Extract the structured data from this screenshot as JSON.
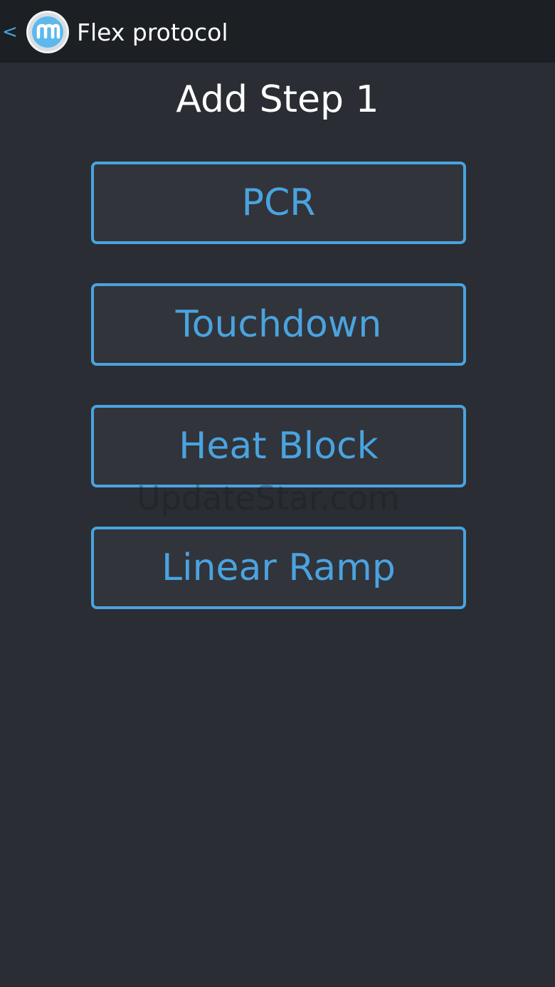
{
  "header": {
    "back_label": "<",
    "app_title": "Flex protocol",
    "logo_letter": "m"
  },
  "page": {
    "title": "Add Step 1"
  },
  "steps": [
    {
      "label": "PCR"
    },
    {
      "label": "Touchdown"
    },
    {
      "label": "Heat Block"
    },
    {
      "label": "Linear Ramp"
    }
  ],
  "watermark": "UpdateStar.com",
  "colors": {
    "accent": "#4aa3df",
    "background": "#2a2d33",
    "topbar": "#1c1f24",
    "button_fill": "#31343b"
  }
}
